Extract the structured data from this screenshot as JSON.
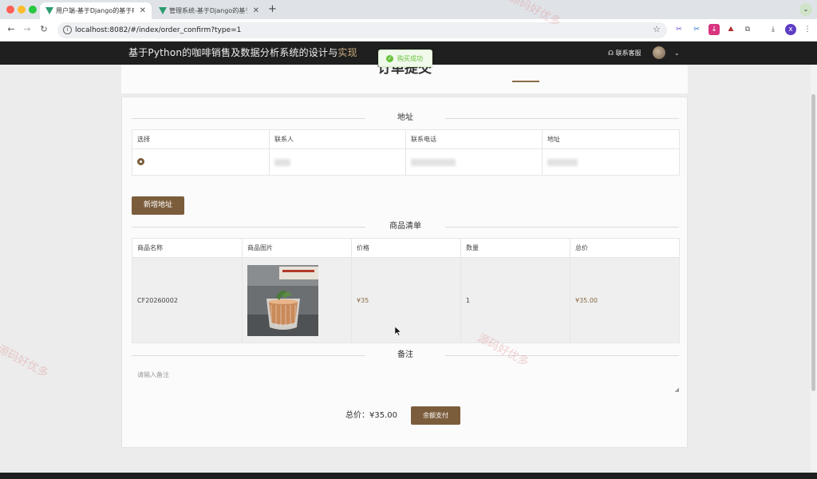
{
  "browser": {
    "tabs": [
      {
        "title": "用户端-基于Django的基于Pyth",
        "active": true
      },
      {
        "title": "管理系统-基于Django的基于Py",
        "active": false
      }
    ],
    "url": "localhost:8082/#/index/order_confirm?type=1"
  },
  "header": {
    "title_main": "基于Python的咖啡销售及数据分析系统的设计与",
    "title_tail": "实现",
    "service_label": "联系客服"
  },
  "toast": {
    "message": "购买成功"
  },
  "page": {
    "title_partial": "订单提交"
  },
  "address_section": {
    "title": "地址",
    "columns": [
      "选择",
      "联系人",
      "联系电话",
      "地址"
    ],
    "add_button": "新增地址"
  },
  "goods_section": {
    "title": "商品清单",
    "columns": [
      "商品名称",
      "商品图片",
      "价格",
      "数量",
      "总价"
    ],
    "rows": [
      {
        "name": "CF20260002",
        "price": "¥35",
        "quantity": "1",
        "total": "¥35.00"
      }
    ]
  },
  "remark_section": {
    "title": "备注",
    "placeholder": "请输入备注"
  },
  "summary": {
    "total_label": "总价：",
    "total_value": "¥35.00",
    "pay_button": "余额支付"
  },
  "watermark": {
    "text": "源码好优多"
  },
  "colors": {
    "accent": "#7b5d3c",
    "header_bg": "#1f1f1f",
    "success": "#67c23a"
  }
}
